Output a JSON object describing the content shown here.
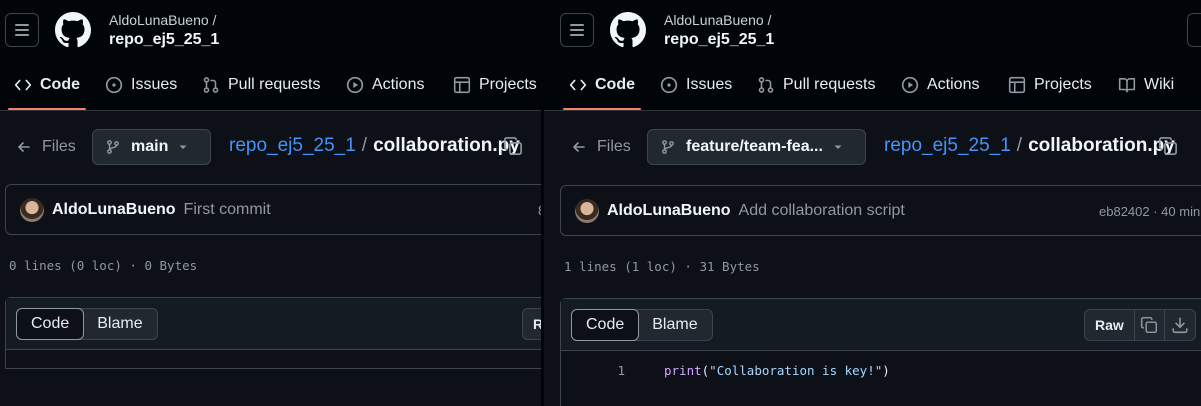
{
  "left": {
    "owner": "AldoLunaBueno /",
    "repo": "repo_ej5_25_1",
    "tabs": [
      "Code",
      "Issues",
      "Pull requests",
      "Actions",
      "Projects"
    ],
    "files_label": "Files",
    "branch": "main",
    "breadcrumb_repo": "repo_ej5_25_1",
    "breadcrumb_sep": "/",
    "breadcrumb_file": "collaboration.py",
    "commit_author": "AldoLunaBueno",
    "commit_message": "First commit",
    "commit_sha_partial": "8",
    "file_meta": "0 lines (0 loc) · 0 Bytes",
    "seg_code": "Code",
    "seg_blame": "Blame",
    "raw_partial": "R"
  },
  "right": {
    "owner": "AldoLunaBueno /",
    "repo": "repo_ej5_25_1",
    "tabs": [
      "Code",
      "Issues",
      "Pull requests",
      "Actions",
      "Projects",
      "Wiki"
    ],
    "files_label": "Files",
    "branch": "feature/team-fea...",
    "breadcrumb_repo": "repo_ej5_25_1",
    "breadcrumb_sep": "/",
    "breadcrumb_file": "collaboration.py",
    "commit_author": "AldoLunaBueno",
    "commit_message": "Add collaboration script",
    "commit_sha": "eb82402 · 40 min",
    "file_meta": "1 lines (1 loc) · 31 Bytes",
    "seg_code": "Code",
    "seg_blame": "Blame",
    "raw_label": "Raw",
    "code_lines": [
      {
        "number": "1",
        "fn": "print",
        "open": "(",
        "str": "\"Collaboration is key!\"",
        "close": ")"
      }
    ]
  },
  "colors": {
    "accent_underline": "#f78166",
    "link": "#4493f8",
    "background": "#0d1117"
  }
}
